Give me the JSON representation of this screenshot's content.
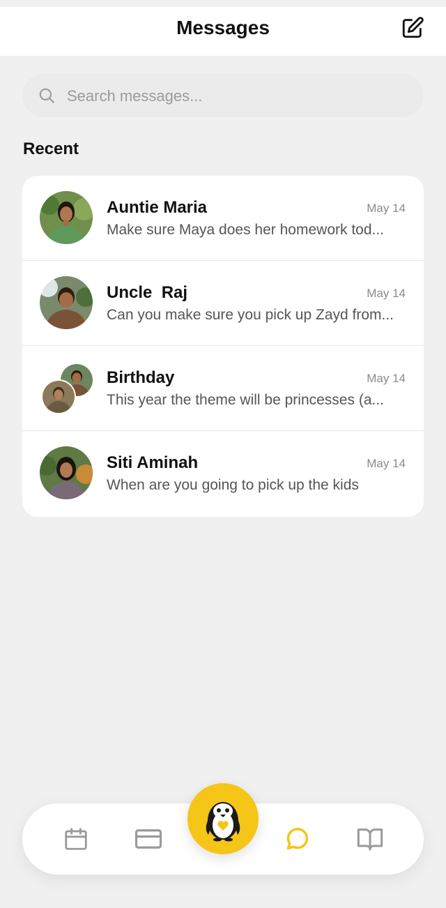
{
  "header": {
    "title": "Messages"
  },
  "search": {
    "placeholder": "Search messages..."
  },
  "section": {
    "title": "Recent"
  },
  "conversations": [
    {
      "name": "Auntie Maria",
      "date": "May 14",
      "preview": "Make sure Maya does her homework  tod..."
    },
    {
      "name": "Uncle  Raj",
      "date": "May 14",
      "preview": "Can you make sure you pick up Zayd from..."
    },
    {
      "name": "Birthday",
      "date": "May 14",
      "preview": "This year the theme will be princesses (a..."
    },
    {
      "name": "Siti Aminah",
      "date": "May 14",
      "preview": "When are you going to pick up the kids"
    }
  ],
  "tabbar": {
    "items": [
      "calendar-icon",
      "card-icon",
      "penguin-logo",
      "chat-bubble-icon",
      "book-open-icon"
    ],
    "active": "chat-bubble-icon"
  },
  "colors": {
    "accent": "#f5c518",
    "background": "#f0f0f0",
    "icon_gray": "#9a9a9a"
  }
}
